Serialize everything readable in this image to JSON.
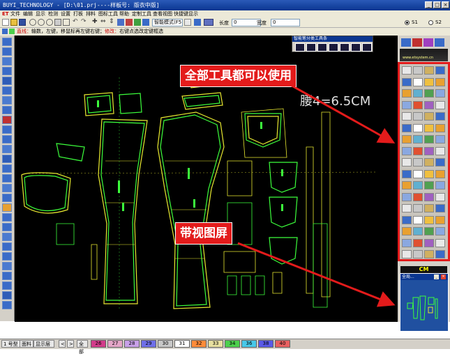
{
  "window": {
    "title": "BUYI_TECHNOLOGY - [D:\\01.prj----样板号: 版衣中版]"
  },
  "menu": {
    "logo": "ET",
    "items": [
      "文件",
      "编辑",
      "显示",
      "检测",
      "设置",
      "打板",
      "排料",
      "图标工具",
      "帮助",
      "定制工具",
      "查看视图",
      "快捷键显示"
    ]
  },
  "toolbar": {
    "mode_select": "智能模式(F5",
    "length_label": "长度",
    "length_value": "0",
    "width_label": "宽度",
    "width_value": "0",
    "radio_s1": "S1",
    "radio_s2": "S2"
  },
  "hint": {
    "part1": "直线：",
    "part2": "输数，左键，移鼠标再左键右键；",
    "part3": "修改：",
    "part4": "右键点选改定键框选"
  },
  "float_toolbar": {
    "title": "智能笔分类工具条"
  },
  "canvas": {
    "waist_label": "腰4=6.5CM"
  },
  "callouts": {
    "tools": "全部工具都可以使用",
    "viewer": "带视图屏"
  },
  "right_panel": {
    "url": "www.etsystem.cn",
    "cm_label": "CM",
    "viewer_title": "全局..."
  },
  "status": {
    "btn1": "1 号型",
    "btn2": "面料",
    "btn3": "显示层",
    "nav_prev": "<",
    "nav_next": ">",
    "all_label": "全部",
    "sizes": [
      "26",
      "27",
      "28",
      "29",
      "30",
      "31",
      "32",
      "33",
      "34",
      "36",
      "38",
      "40"
    ],
    "size_colors": [
      "#d23b8a",
      "#e4a6c8",
      "#c8a0e8",
      "#6f6fe8",
      "#c8c8c8",
      "#ffffff",
      "#ff8c3a",
      "#e8e0a0",
      "#4cd04c",
      "#48c8e8",
      "#5a5ae8",
      "#e86060"
    ]
  },
  "colors": {
    "accent_red": "#e31b1b",
    "canvas_bg": "#000000",
    "pattern_yellow": "#e8e830",
    "pattern_green": "#3cff3c",
    "titlebar_blue": "#0b3690"
  }
}
